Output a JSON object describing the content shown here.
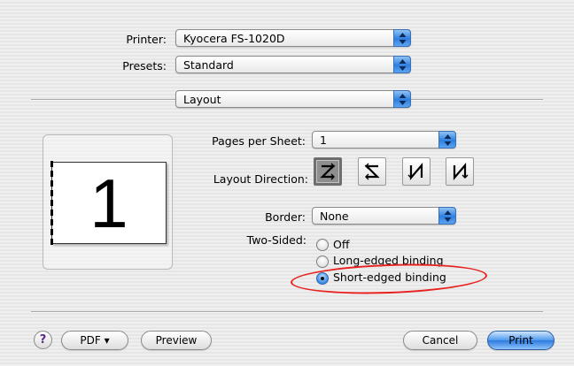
{
  "printer": {
    "label": "Printer:",
    "value": "Kyocera FS-1020D"
  },
  "presets": {
    "label": "Presets:",
    "value": "Standard"
  },
  "panel": {
    "value": "Layout"
  },
  "preview": {
    "page_number": "1"
  },
  "pages_per_sheet": {
    "label": "Pages per Sheet:",
    "value": "1"
  },
  "layout_direction": {
    "label": "Layout Direction:",
    "options": [
      {
        "icon": "z-left-right-top-bottom-icon",
        "selected": true
      },
      {
        "icon": "reverse-s-right-left-top-bottom-icon",
        "selected": false
      },
      {
        "icon": "n-mirrored-top-bottom-left-right-icon",
        "selected": false
      },
      {
        "icon": "n-top-bottom-right-left-icon",
        "selected": false
      }
    ]
  },
  "border": {
    "label": "Border:",
    "value": "None"
  },
  "two_sided": {
    "label": "Two-Sided:",
    "options": [
      {
        "label": "Off",
        "selected": false
      },
      {
        "label": "Long-edged binding",
        "selected": false
      },
      {
        "label": "Short-edged binding",
        "selected": true
      }
    ],
    "highlight_color": "#e8201e"
  },
  "footer": {
    "help": "?",
    "pdf_label": "PDF ▾",
    "preview_label": "Preview",
    "cancel_label": "Cancel",
    "print_label": "Print"
  },
  "colors": {
    "accent": "#2f7fe0",
    "highlight": "#e8201e"
  }
}
